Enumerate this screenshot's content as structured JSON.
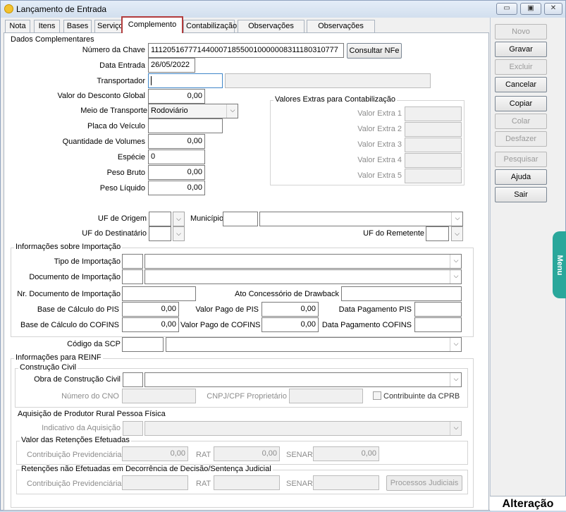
{
  "window": {
    "title": "Lançamento de Entrada",
    "btn_min": "▭",
    "btn_max": "▣",
    "btn_close": "✕"
  },
  "tabs": [
    {
      "label": "Nota"
    },
    {
      "label": "Itens"
    },
    {
      "label": "Bases"
    },
    {
      "label": "Serviço"
    },
    {
      "label": "Complemento"
    },
    {
      "label": "Contabilização"
    },
    {
      "label": "Observações EFD"
    },
    {
      "label": "Observações Fisco"
    }
  ],
  "dados": {
    "group": "Dados Complementares",
    "chave_label": "Número da Chave",
    "chave_value": "11120516777144000718550010000008311180310777",
    "consultar_label": "Consultar NFe",
    "data_label": "Data Entrada",
    "data_value": "26/05/2022",
    "transportador_label": "Transportador",
    "desconto_label": "Valor do Desconto Global",
    "desconto_value": "0,00",
    "meio_label": "Meio de Transporte",
    "meio_value": "Rodoviário",
    "placa_label": "Placa do Veículo",
    "qtd_label": "Quantidade de Volumes",
    "qtd_value": "0,00",
    "especie_label": "Espécie",
    "especie_value": "0",
    "bruto_label": "Peso Bruto",
    "bruto_value": "0,00",
    "liquido_label": "Peso Líquido",
    "liquido_value": "0,00"
  },
  "extras": {
    "group": "Valores Extras para Contabilização",
    "labels": [
      "Valor Extra 1",
      "Valor Extra 2",
      "Valor Extra 3",
      "Valor Extra 4",
      "Valor Extra 5"
    ]
  },
  "uf": {
    "origem_label": "UF de Origem",
    "municipio_label": "Município",
    "destinatario_label": "UF do Destinatário",
    "remetente_label": "UF do Remetente"
  },
  "importacao": {
    "group": "Informações sobre Importação",
    "tipo_label": "Tipo de Importação",
    "documento_label": "Documento de Importação",
    "nr_label": "Nr. Documento de Importação",
    "ato_label": "Ato Concessório de Drawback",
    "base_pis_label": "Base de Cálculo do PIS",
    "base_pis_value": "0,00",
    "pago_pis_label": "Valor Pago de PIS",
    "pago_pis_value": "0,00",
    "data_pis_label": "Data Pagamento PIS",
    "base_cofins_label": "Base de Cálculo do COFINS",
    "base_cofins_value": "0,00",
    "pago_cofins_label": "Valor Pago de COFINS",
    "pago_cofins_value": "0,00",
    "data_cofins_label": "Data Pagamento COFINS"
  },
  "scp": {
    "label": "Código da SCP"
  },
  "reinf": {
    "group": "Informações para REINF",
    "construcao_group": "Construção Civil",
    "obra_label": "Obra de Construção Civil",
    "cno_label": "Número do CNO",
    "cnpj_label": "CNPJ/CPF Proprietário",
    "cprb_label": "Contribuinte da CPRB",
    "aquisicao_group": "Aquisição de Produtor Rural Pessoa Física",
    "indicativo_label": "Indicativo da Aquisição",
    "retencoes_group": "Valor das Retenções Efetuadas",
    "contrib_label": "Contribuição Previdenciária",
    "contrib_value": "0,00",
    "rat_label": "RAT",
    "rat_value": "0,00",
    "senar_label": "SENAR",
    "senar_value": "0,00",
    "nao_efetuadas_group": "Retenções não Efetuadas em Decorrência de Decisão/Sentença Judicial",
    "contrib2_label": "Contribuição Previdenciária",
    "rat2_label": "RAT",
    "senar2_label": "SENAR",
    "processos_label": "Processos Judiciais"
  },
  "sidebar": {
    "novo": "Novo",
    "gravar": "Gravar",
    "excluir": "Excluir",
    "cancelar": "Cancelar",
    "copiar": "Copiar",
    "colar": "Colar",
    "desfazer": "Desfazer",
    "pesquisar": "Pesquisar",
    "ajuda": "Ajuda",
    "sair": "Sair"
  },
  "menu_tab": "Menu",
  "status": "Alteração",
  "colors": {
    "accent_tab_border": "#b23c3c",
    "menu_tab": "#2aa79b",
    "focus_border": "#3f86c9"
  }
}
